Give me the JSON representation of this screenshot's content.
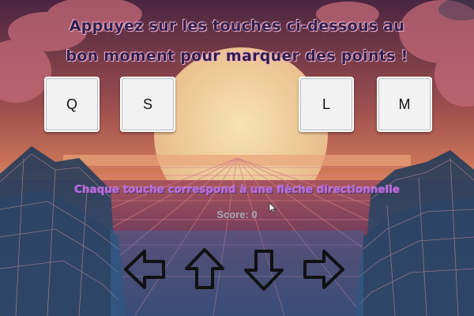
{
  "instructions": {
    "line1": "Appuyez sur les touches ci-dessous au",
    "line2": "bon moment pour marquer des points !"
  },
  "keys": [
    {
      "label": "Q"
    },
    {
      "label": "S"
    },
    {
      "label": "L"
    },
    {
      "label": "M"
    }
  ],
  "hint": "Chaque touche correspond à une flèche directionnelle",
  "score": {
    "text": "Score: 0",
    "value": 0
  },
  "arrows": [
    {
      "icon": "arrow-left-icon"
    },
    {
      "icon": "arrow-up-icon"
    },
    {
      "icon": "arrow-down-icon"
    },
    {
      "icon": "arrow-right-icon"
    }
  ],
  "colors": {
    "sky_top": "#5a2a4a",
    "sun": "#f3d5a0",
    "grid_line": "#c47080",
    "heading_text": "#2e1f4f",
    "hint_text": "#b86be0",
    "score_text": "#a7a7b3",
    "arrow_outline": "#111111"
  }
}
